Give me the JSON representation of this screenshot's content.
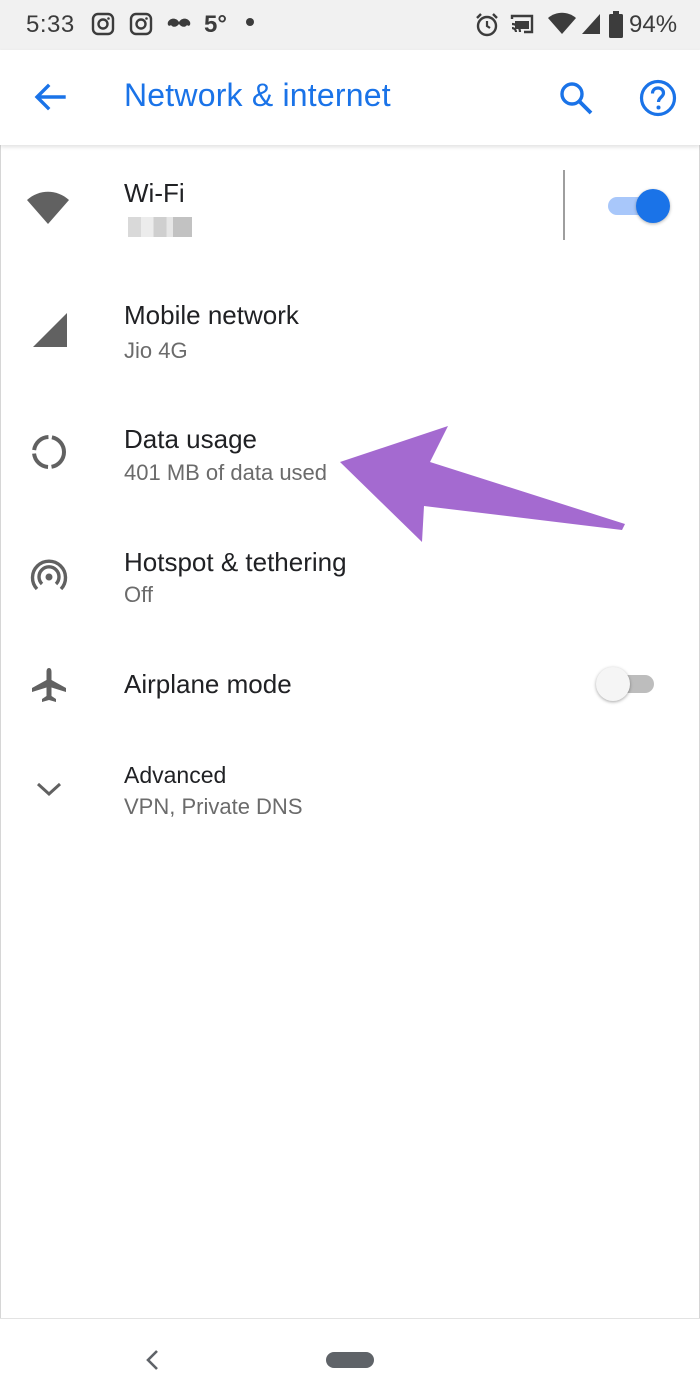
{
  "status_bar": {
    "time": "5:33",
    "temperature": "5°",
    "battery": "94%",
    "icons": [
      "instagram-icon",
      "instagram-icon",
      "mustache-icon",
      "alarm-icon",
      "cast-icon",
      "wifi-icon",
      "signal-icon",
      "battery-icon"
    ]
  },
  "app_bar": {
    "title": "Network & internet",
    "accent_color": "#1a73e8"
  },
  "settings": {
    "wifi": {
      "title": "Wi-Fi",
      "enabled": true
    },
    "mobile": {
      "title": "Mobile network",
      "subtitle": "Jio 4G"
    },
    "data_usage": {
      "title": "Data usage",
      "subtitle": "401 MB of data used"
    },
    "hotspot": {
      "title": "Hotspot & tethering",
      "subtitle": "Off"
    },
    "airplane": {
      "title": "Airplane mode",
      "enabled": false
    },
    "advanced": {
      "title": "Advanced",
      "subtitle": "VPN, Private DNS"
    }
  },
  "annotation": {
    "arrow_color": "#a46ad0",
    "points_to": "data usage"
  }
}
